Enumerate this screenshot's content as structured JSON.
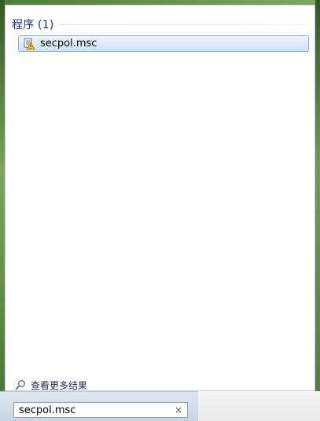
{
  "results_section": {
    "title": "程序 (1)"
  },
  "results": [
    {
      "label": "secpol.msc",
      "icon": "security-policy-icon"
    }
  ],
  "more_results": {
    "label": "查看更多结果",
    "icon": "search-magnifier-icon"
  },
  "search": {
    "value": "secpol.msc",
    "clear_glyph": "×"
  },
  "colors": {
    "section_title": "#1e3287",
    "selected_item_border": "#84acdd",
    "selected_item_bg": "#dcebfc"
  }
}
